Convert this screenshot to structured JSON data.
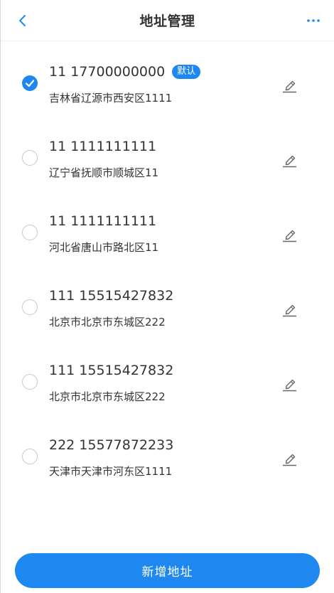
{
  "header": {
    "title": "地址管理",
    "back_icon": "chevron-left-icon",
    "more_icon": "more-dots-icon"
  },
  "colors": {
    "accent": "#1e88f0",
    "text": "#333333",
    "border": "#c8c8c8"
  },
  "addresses": [
    {
      "phone": "11 17700000000",
      "address": "吉林省辽源市西安区1111",
      "is_default": true,
      "default_label": "默认",
      "selected": true
    },
    {
      "phone": "11 1111111111",
      "address": "辽宁省抚顺市顺城区11",
      "is_default": false,
      "selected": false
    },
    {
      "phone": "11 1111111111",
      "address": "河北省唐山市路北区11",
      "is_default": false,
      "selected": false
    },
    {
      "phone": "111 15515427832",
      "address": "北京市北京市东城区222",
      "is_default": false,
      "selected": false
    },
    {
      "phone": "111 15515427832",
      "address": "北京市北京市东城区222",
      "is_default": false,
      "selected": false
    },
    {
      "phone": "222 15577872233",
      "address": "天津市天津市河东区1111",
      "is_default": false,
      "selected": false
    }
  ],
  "footer": {
    "add_button_label": "新增地址"
  }
}
